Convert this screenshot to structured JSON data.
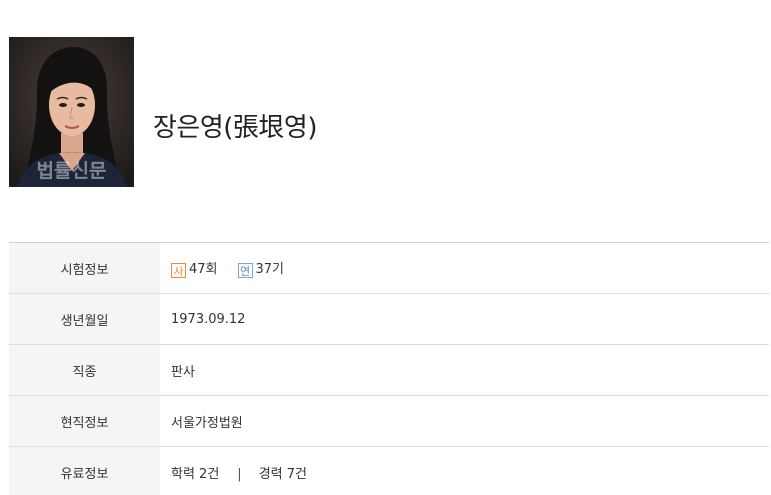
{
  "profile": {
    "name": "장은영(張垠영)",
    "photo_watermark": "법률신문"
  },
  "rows": [
    {
      "label": "시험정보",
      "exams": [
        {
          "badge": "사",
          "value": "47회"
        },
        {
          "badge": "연",
          "value": "37기"
        }
      ]
    },
    {
      "label": "생년월일",
      "value": "1973.09.12"
    },
    {
      "label": "직종",
      "value": "판사"
    },
    {
      "label": "현직정보",
      "value": "서울가정법원"
    },
    {
      "label": "유료정보",
      "education": "학력 2건",
      "separator": "|",
      "career": "경력 7건"
    }
  ],
  "colors": {
    "badge_sa": "#f08a3c",
    "badge_yeon": "#7aa8d6",
    "label_bg": "#f5f5f5",
    "border": "#dddddd"
  }
}
